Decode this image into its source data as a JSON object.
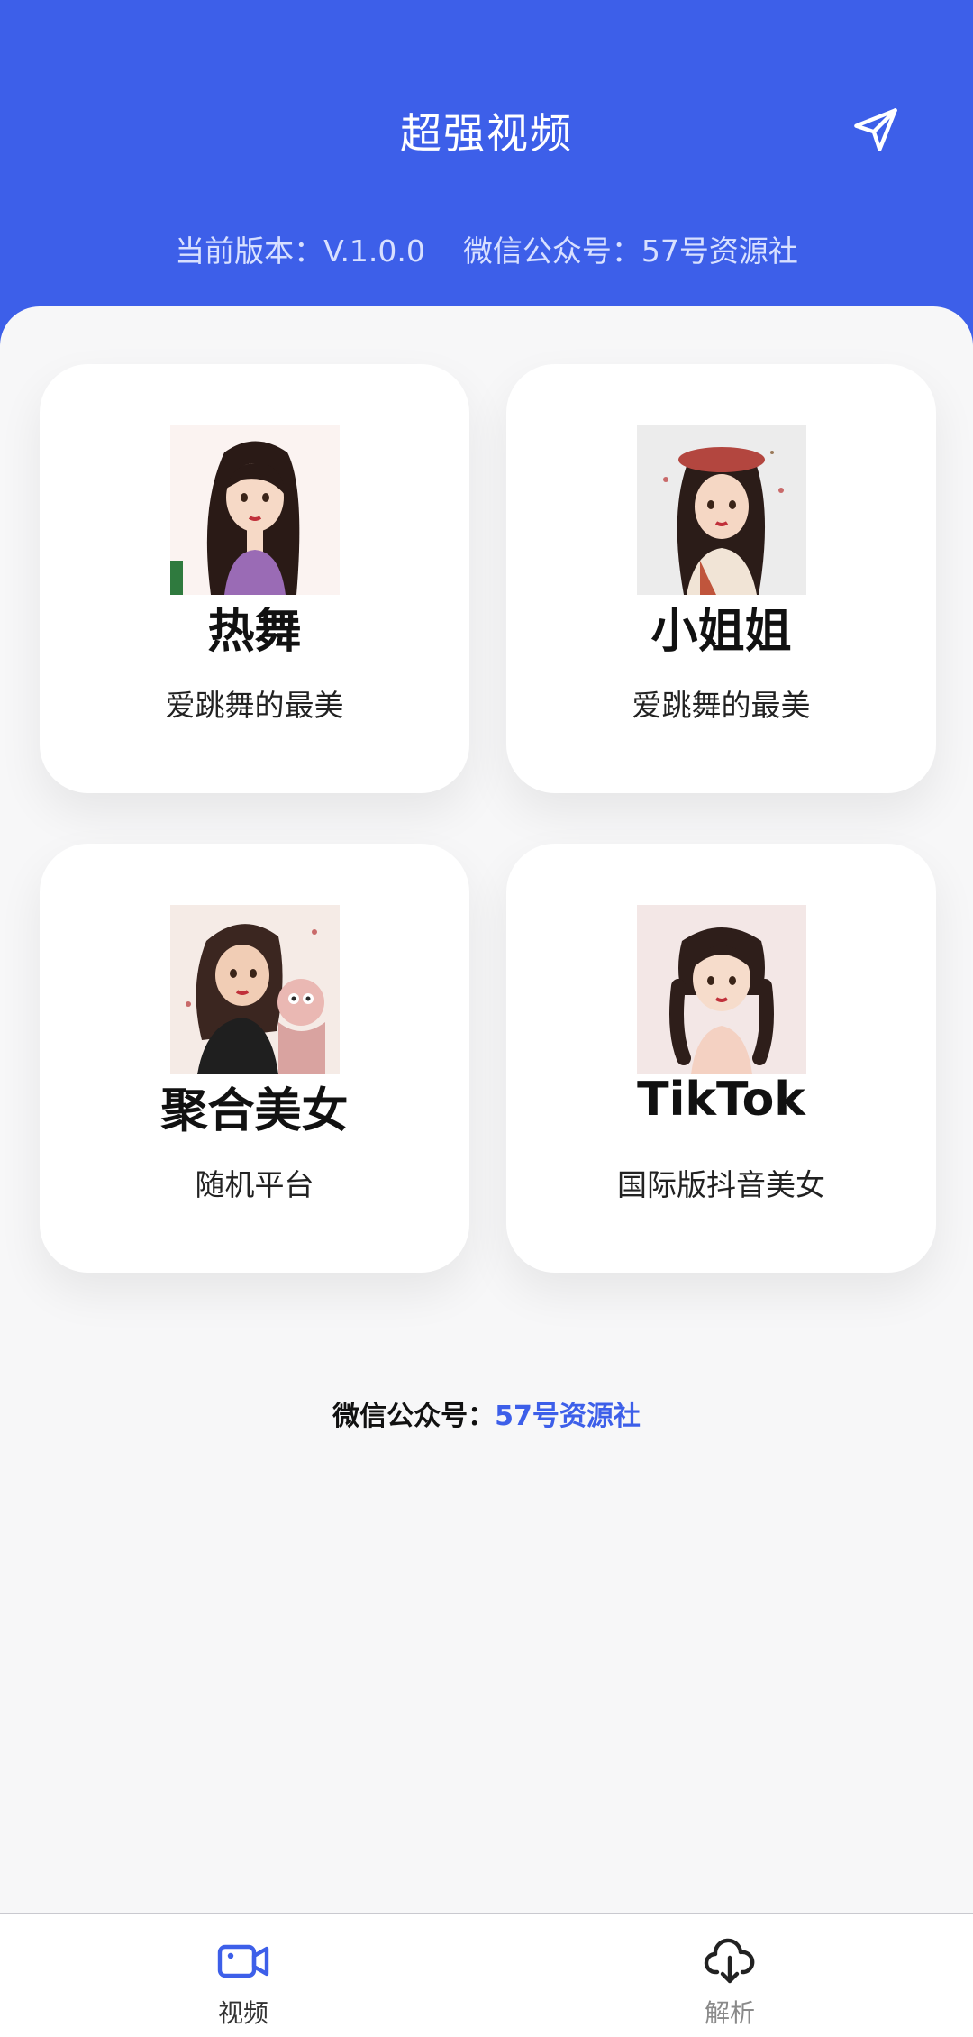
{
  "colors": {
    "primary": "#3d5fe9",
    "background": "#f7f7f8",
    "card": "#ffffff"
  },
  "header": {
    "title": "超强视频",
    "version_text": "当前版本：V.1.0.0    微信公众号：57号资源社",
    "send_icon": "send-icon"
  },
  "cards": [
    {
      "title": "热舞",
      "subtitle": "爱跳舞的最美",
      "thumbnail": "illustration-girl-long-hair"
    },
    {
      "title": "小姐姐",
      "subtitle": "爱跳舞的最美",
      "thumbnail": "illustration-girl-with-hat"
    },
    {
      "title": "聚合美女",
      "subtitle": "随机平台",
      "thumbnail": "illustration-girl-with-plush"
    },
    {
      "title": "TikTok",
      "subtitle": "国际版抖音美女",
      "thumbnail": "illustration-girl-braids"
    }
  ],
  "footer_note": {
    "label": "微信公众号：",
    "value": "57号资源社"
  },
  "tabbar": {
    "tabs": [
      {
        "label": "视频",
        "icon": "video-camera-icon",
        "active": true
      },
      {
        "label": "解析",
        "icon": "cloud-download-icon",
        "active": false
      }
    ]
  }
}
